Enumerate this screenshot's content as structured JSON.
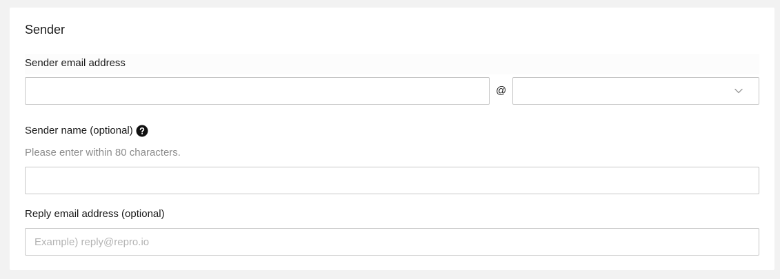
{
  "section": {
    "title": "Sender"
  },
  "sender_email": {
    "label": "Sender email address",
    "local_value": "",
    "at_symbol": "@",
    "domain_selected": ""
  },
  "sender_name": {
    "label": "Sender name (optional)",
    "help_icon": "question-circle-icon",
    "hint": "Please enter within 80 characters.",
    "value": ""
  },
  "reply_email": {
    "label": "Reply email address (optional)",
    "placeholder": "Example) reply@repro.io",
    "value": ""
  },
  "colors": {
    "border": "#c6c6c6",
    "hint_text": "#8c8c8c",
    "page_background": "#f2f2f2"
  }
}
